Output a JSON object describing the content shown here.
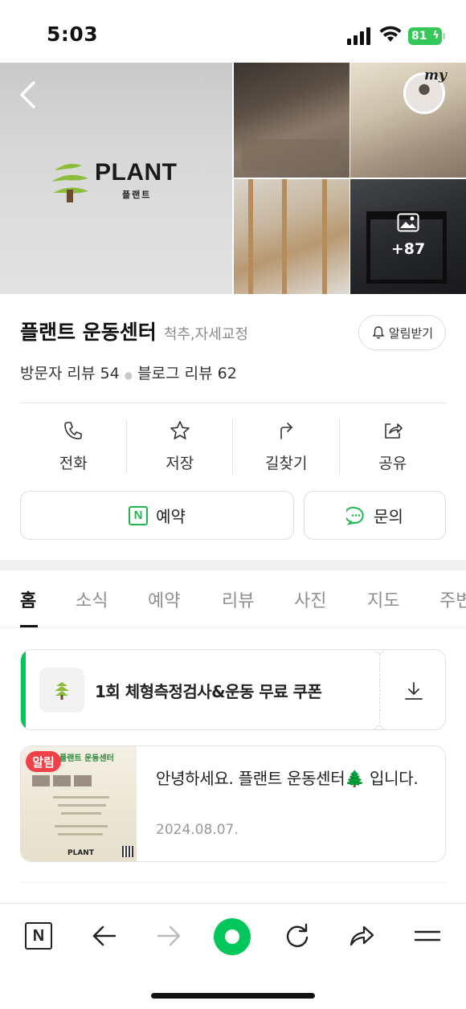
{
  "status_bar": {
    "time": "5:03",
    "battery": "81"
  },
  "hero": {
    "logo_name": "PLANT",
    "logo_sub": "플랜트",
    "photo_more_count": "+87",
    "my_label": "my"
  },
  "place": {
    "name": "플랜트 운동센터",
    "category": "척추,자세교정",
    "alarm_label": "알림받기",
    "visitor_reviews": "방문자 리뷰 54",
    "blog_reviews": "블로그 리뷰 62"
  },
  "actions": [
    {
      "label": "전화",
      "icon": "phone-icon"
    },
    {
      "label": "저장",
      "icon": "star-icon"
    },
    {
      "label": "길찾기",
      "icon": "directions-icon"
    },
    {
      "label": "공유",
      "icon": "share-icon"
    }
  ],
  "buttons": {
    "reserve": "예약",
    "inquire": "문의"
  },
  "tabs": [
    "홈",
    "소식",
    "예약",
    "리뷰",
    "사진",
    "지도",
    "주변"
  ],
  "active_tab": "홈",
  "coupon": {
    "text": "1회 체형측정검사&운동 무료 쿠폰"
  },
  "news": {
    "badge": "알림",
    "poster_title": "플랜트 운동센터",
    "title": "안녕하세요. 플랜트 운동센터🌲 입니다.",
    "date": "2024.08.07."
  },
  "colors": {
    "brand_green": "#03c75a",
    "badge_red": "#ef4148",
    "battery_green": "#34c759"
  }
}
